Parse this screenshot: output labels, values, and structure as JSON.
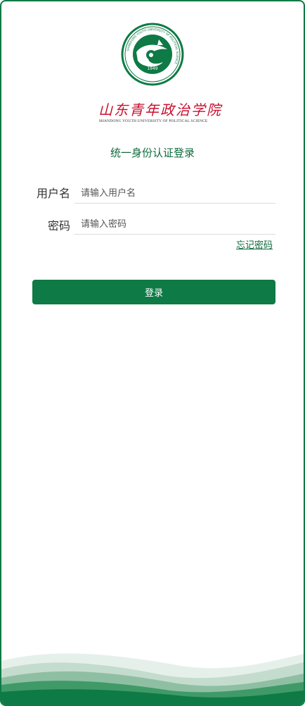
{
  "logo": {
    "emblem_year": "1949",
    "emblem_ring_text": "SHANDONG YOUTH UNIVERSITY OF POLITICAL SCIENCE",
    "school_name_cn": "山东青年政治学院",
    "school_name_en": "SHANDONG YOUTH UNIVERSITY OF POLITICAL SCIENCE"
  },
  "form": {
    "title": "统一身份认证登录",
    "username_label": "用户名",
    "username_placeholder": "请输入用户名",
    "password_label": "密码",
    "password_placeholder": "请输入密码",
    "forgot_password": "忘记密码",
    "login_button": "登录"
  },
  "colors": {
    "brand_green": "#0e7a45",
    "logo_red": "#c8102e"
  }
}
